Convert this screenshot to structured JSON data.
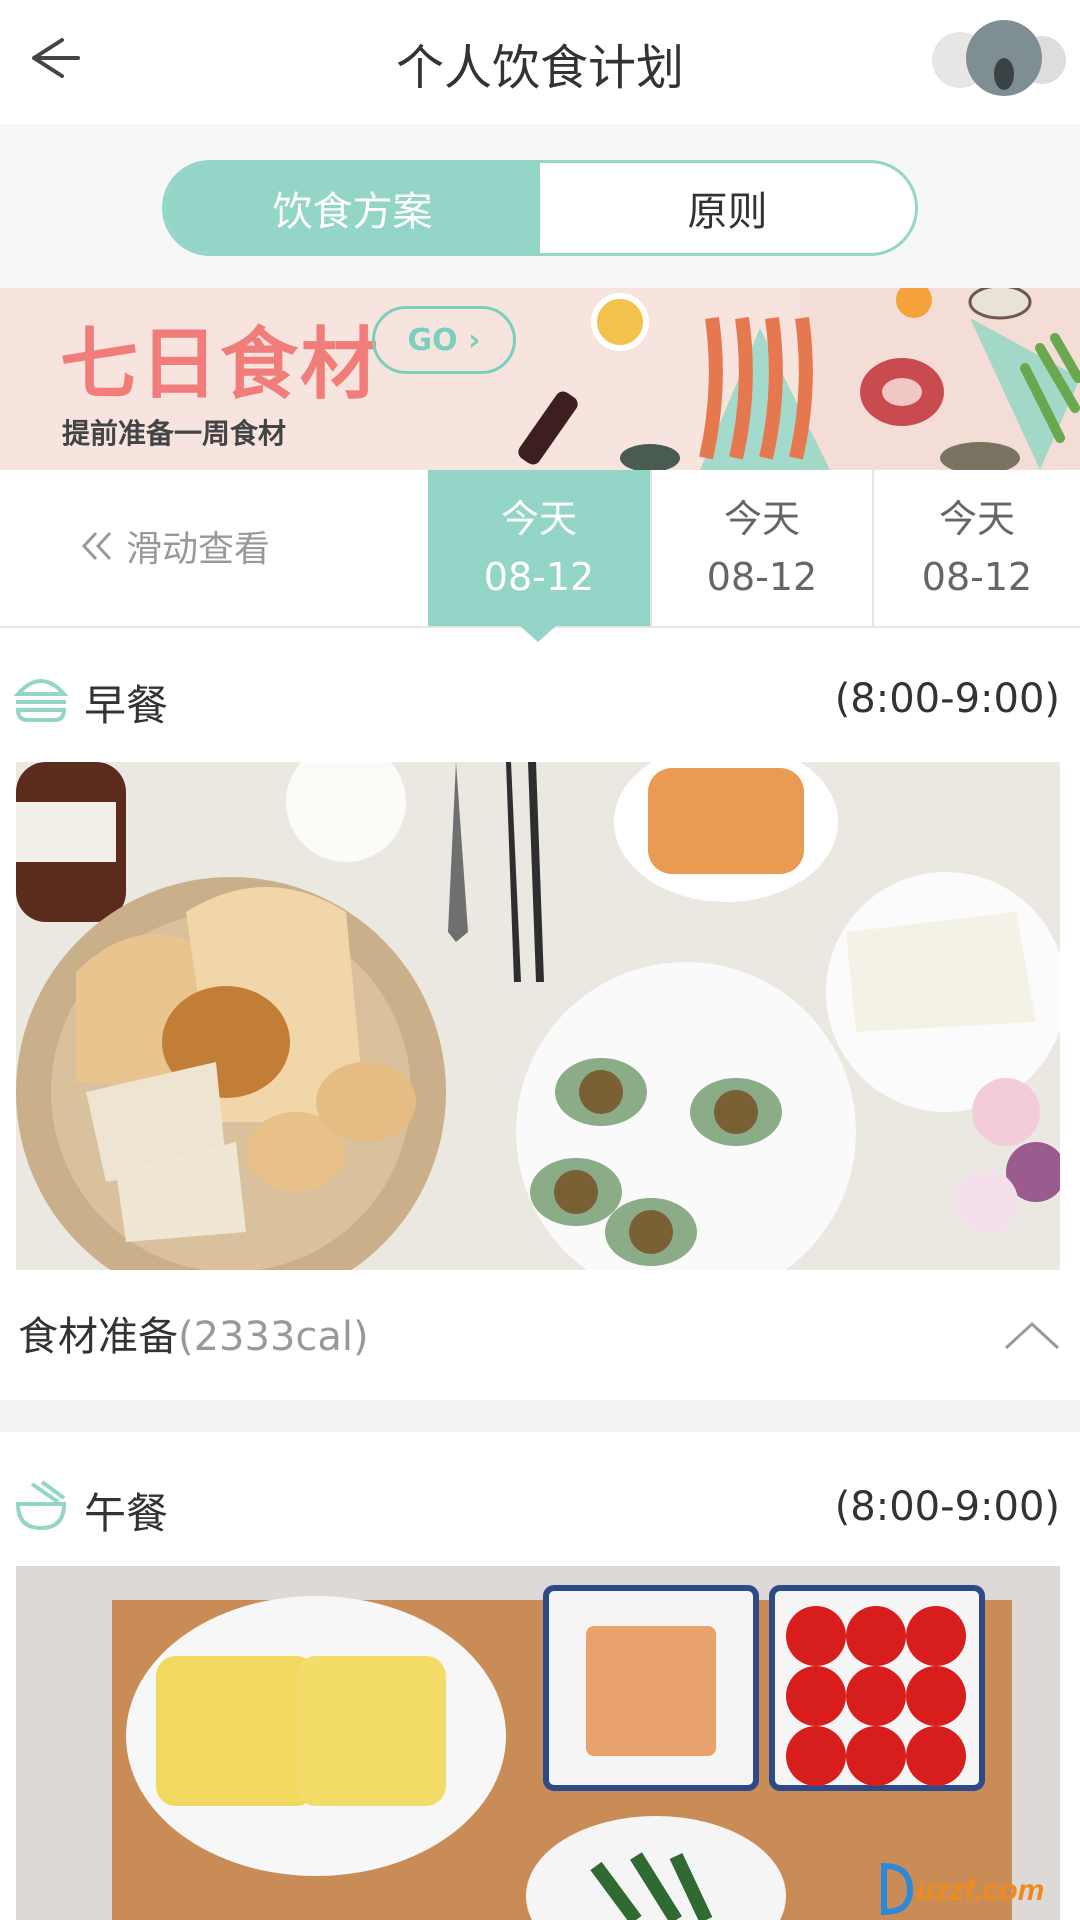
{
  "header": {
    "title": "个人饮食计划"
  },
  "segments": [
    {
      "label": "饮食方案",
      "active": true
    },
    {
      "label": "原则",
      "active": false
    }
  ],
  "banner": {
    "title": "七日食材",
    "go_label": "GO ›",
    "subtitle": "提前准备一周食材"
  },
  "date_strip": {
    "swipe_hint": "滑动查看",
    "days": [
      {
        "label": "今天",
        "date": "08-12",
        "active": true
      },
      {
        "label": "今天",
        "date": "08-12",
        "active": false
      },
      {
        "label": "今天",
        "date": "08-12",
        "active": false
      }
    ]
  },
  "meals": [
    {
      "name": "早餐",
      "time": "(8:00-9:00)",
      "icon": "burger-icon"
    },
    {
      "name": "午餐",
      "time": "(8:00-9:00)",
      "icon": "noodle-bowl-icon"
    }
  ],
  "ingredients": {
    "label": "食材准备",
    "calories": "(2333cal)"
  },
  "watermark": {
    "text": "uzzf.com"
  },
  "colors": {
    "accent": "#93d5c6",
    "banner_bg": "#f7e4df",
    "banner_title": "#f17d7b"
  }
}
